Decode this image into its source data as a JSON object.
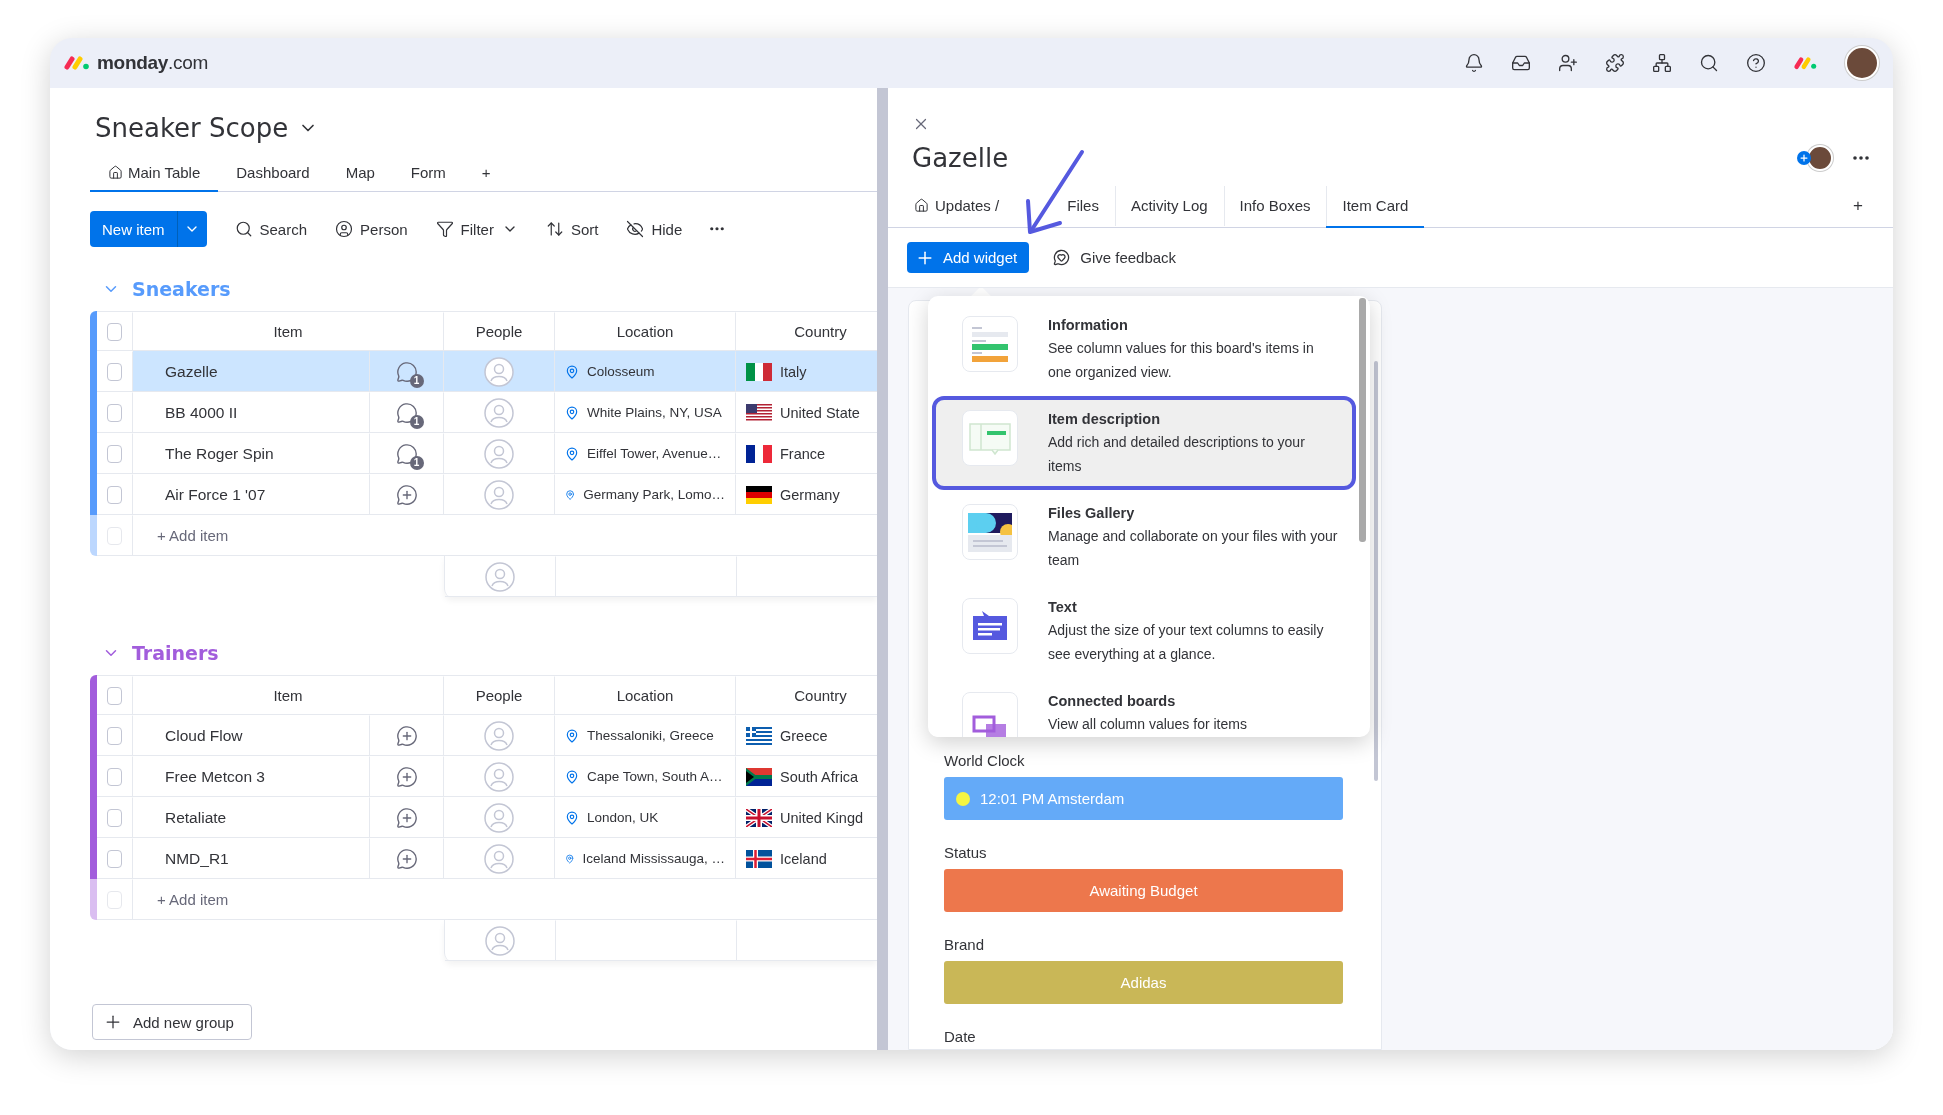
{
  "topbar": {
    "logo": "**monday**.com"
  },
  "board": {
    "title": "Sneaker Scope",
    "views": [
      {
        "label": "Main Table",
        "kind": "home",
        "selected": true
      },
      {
        "label": "Dashboard",
        "kind": "plain",
        "selected": false
      },
      {
        "label": "Map",
        "kind": "plain",
        "selected": false
      },
      {
        "label": "Form",
        "kind": "plain",
        "selected": false
      },
      {
        "label": "+",
        "kind": "plain",
        "selected": false
      }
    ],
    "toolbar": {
      "new_item": "New item",
      "actions": [
        {
          "label": "Search",
          "kind": "search"
        },
        {
          "label": "Person",
          "kind": "person"
        },
        {
          "label": "Filter",
          "kind": "filter"
        },
        {
          "label": "Sort",
          "kind": "sort"
        },
        {
          "label": "Hide",
          "kind": "hide"
        }
      ]
    },
    "groups": [
      {
        "name": "Sneakers",
        "color": "#579bfc",
        "columns": [
          "Item",
          "People",
          "Location",
          "Country"
        ],
        "add_item": "+ Add item",
        "header_checked": false,
        "new_item_checked": false,
        "rows": [
          {
            "item": "Gazelle",
            "updates": "1",
            "location": "Colosseum",
            "country": "Italy",
            "selected": true,
            "checked": false
          },
          {
            "item": "BB 4000 II",
            "updates": "1",
            "location": "White Plains, NY, USA",
            "country": "United State",
            "selected": false,
            "checked": false
          },
          {
            "item": "The Roger Spin",
            "updates": "1",
            "location": "Eiffel Tower, Avenue…",
            "country": "France",
            "selected": false,
            "checked": false
          },
          {
            "item": "Air Force 1 '07",
            "location": "Germany Park, Lomo…",
            "country": "Germany",
            "selected": false,
            "checked": false
          }
        ]
      },
      {
        "name": "Trainers",
        "color": "#a25ddc",
        "columns": [
          "Item",
          "People",
          "Location",
          "Country"
        ],
        "add_item": "+ Add item",
        "header_checked": false,
        "new_item_checked": false,
        "rows": [
          {
            "item": "Cloud Flow",
            "location": "Thessaloniki, Greece",
            "country": "Greece",
            "selected": false,
            "checked": false
          },
          {
            "item": "Free Metcon 3",
            "location": "Cape Town, South A…",
            "country": "South Africa",
            "selected": false,
            "checked": false
          },
          {
            "item": "Retaliate",
            "location": "London, UK",
            "country": "United Kingd",
            "selected": false,
            "checked": false
          },
          {
            "item": "NMD_R1",
            "location": "Iceland Mississauga, …",
            "country": "Iceland",
            "selected": false,
            "checked": false
          }
        ]
      }
    ],
    "add_group": "Add new group"
  },
  "item_panel": {
    "title": "Gazelle",
    "tabs": [
      {
        "label": "Updates /",
        "kind": "home",
        "selected": false
      },
      {
        "label": "Files",
        "kind": "plain",
        "selected": false
      },
      {
        "label": "Activity Log",
        "kind": "plain",
        "selected": false
      },
      {
        "label": "Info Boxes",
        "kind": "plain",
        "selected": false
      },
      {
        "label": "Item Card",
        "kind": "plain",
        "selected": true
      }
    ],
    "add_tab": "+",
    "add_widget": "Add widget",
    "feedback": "Give feedback",
    "widget_menu": [
      {
        "title": "Information",
        "description": "See column values for this board's items in one organized view.",
        "kind": "info",
        "selected": false
      },
      {
        "title": "Item description",
        "description": "Add rich and detailed descriptions to your items",
        "kind": "description",
        "selected": true
      },
      {
        "title": "Files Gallery",
        "description": "Manage and collaborate on your files with your team",
        "kind": "gallery",
        "selected": false
      },
      {
        "title": "Text",
        "description": "Adjust the size of your text columns to easily see everything at a glance.",
        "kind": "text",
        "selected": false
      },
      {
        "title": "Connected boards",
        "description": "View all column values for items",
        "kind": "connected",
        "selected": false
      }
    ],
    "fields": [
      {
        "label": "World Clock",
        "kind": "clock",
        "value": "12:01 PM Amsterdam",
        "color": "#64aaf8"
      },
      {
        "label": "Status",
        "kind": "status",
        "value": "Awaiting Budget",
        "color": "#ed774c"
      },
      {
        "label": "Brand",
        "kind": "status",
        "value": "Adidas",
        "color": "#c9b757"
      },
      {
        "label": "Date",
        "kind": "empty"
      }
    ]
  }
}
